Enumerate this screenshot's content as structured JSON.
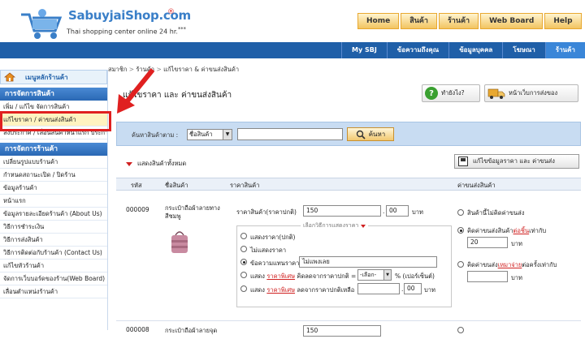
{
  "header": {
    "brand_part1": "Sabuyjai",
    "brand_part2": "Shop.com",
    "reg_mark": "®",
    "tagline": "Thai shopping center online 24 hr.",
    "tagline_mark": "***",
    "nav": [
      "Home",
      "สินค้า",
      "ร้านค้า",
      "Web Board",
      "Help"
    ],
    "subnav": [
      "My SBJ",
      "ข้อความถึงคุณ",
      "ข้อมูลบุคคล",
      "โฆษณา",
      "ร้านค้า"
    ],
    "subnav_active": 4
  },
  "sidebar": {
    "home_label": "เมนูหลักร้านค้า",
    "section1": "การจัดการสินค้า",
    "items1": [
      "เพิ่ม / แก้ไข จัดการสินค้า",
      "แก้ไขราคา / ค่าขนส่งสินค้า",
      "ลงประกาศ / เลื่อนสินค้าหน้าแรก ประกาศ"
    ],
    "highlight_index": 1,
    "section2": "การจัดการร้านค้า",
    "items2": [
      "เปลี่ยนรูปแบบร้านค้า",
      "กำหนดสถานะเปิด / ปิดร้าน",
      "ข้อมูลร้านค้า",
      "หน้าแรก",
      "ข้อมูลรายละเอียดร้านค้า (About Us)",
      "วิธีการชำระเงิน",
      "วิธีการส่งสินค้า",
      "วิธีการติดต่อกับร้านค้า (Contact Us)",
      "แก้ไขหัวร้านค้า",
      "จัดการเว็บบอร์ดของร้าน(Web Board)",
      "เลื่อนตำแหน่งร้านค้า"
    ]
  },
  "main": {
    "breadcrumb": [
      "สมาชิก",
      "ร้านค้า",
      "แก้ไขราคา & ค่าขนส่งสินค้า"
    ],
    "page_title": "แก้ไขราคา และ ค่าขนส่งสินค้า",
    "help_button": "ทำยังไง?",
    "ship_button": "หน้าเว็บการส่งของ",
    "search_label": "ค้นหาสินค้าตาม :",
    "search_select": "ชื่อสินค้า",
    "search_button": "ค้นหา",
    "show_all": "แสดงสินค้าทั้งหมด",
    "save_button": "แก้ไขข้อมูลราคา และ ค่าขนส่ง",
    "columns": [
      "รหัส",
      "ชื่อสินค้า",
      "ราคาสินค้า",
      "ค่าขนส่งสินค้า"
    ]
  },
  "product1": {
    "code": "000009",
    "name": "กระเป๋าถือผ้าลายทางสีชมพู",
    "price_label": "ราคาสินค้า(ราคาปกติ)",
    "price_baht": "150",
    "price_satang": "00",
    "unit": "บาท",
    "options_legend": "เลือกวิธีการแสดงราคา",
    "opt1": "แสดงราคา(ปกติ)",
    "opt2": "ไม่แสดงราคา",
    "opt3": "ข้อความแทนราคา",
    "opt3_value": "ไม่แพงเลย",
    "opt4_pre": "แสดง",
    "opt4_link": "ราคาพิเศษ",
    "opt4_post": "คิดลดจากราคาปกติ =",
    "opt4_select": "-เลือก-",
    "opt4_unit": "% (เปอร์เซ็นต์)",
    "opt5_pre": "แสดง",
    "opt5_link": "ราคาพิเศษ",
    "opt5_post": "ลดจากราคาปกติเหลือ",
    "opt5_satang": "00",
    "opt5_unit": "บาท",
    "ship_opt1": "สินค้านี้ไม่คิดค่าขนส่ง",
    "ship_opt2_pre": "คิดค่าขนส่งสินค้า",
    "ship_opt2_link": "ต่อชิ้น",
    "ship_opt2_post": "เท่ากับ",
    "ship_opt2_value": "20",
    "ship_opt3_pre": "คิดค่าขนส่ง",
    "ship_opt3_link": "เหมาจ่าย",
    "ship_opt3_post": "ต่อครั้งเท่ากับ",
    "ship_unit": "บาท"
  },
  "product2": {
    "code": "000008",
    "name": "กระเป๋าถือผ้าลายจุด",
    "price_baht": "150"
  },
  "colors": {
    "accent": "#1f5fa8",
    "highlight": "#e02020",
    "nav_orange": "#f2c460"
  }
}
